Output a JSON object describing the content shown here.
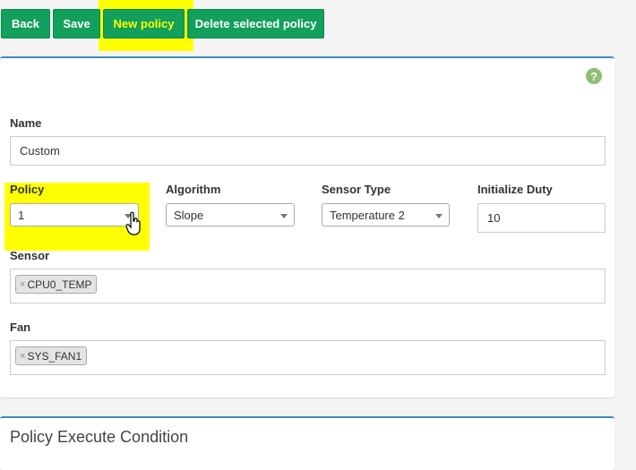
{
  "toolbar": {
    "back_label": "Back",
    "save_label": "Save",
    "new_policy_label": "New policy",
    "delete_label": "Delete selected policy"
  },
  "help_icon": "question-circle-icon",
  "form": {
    "name_label": "Name",
    "name_value": "Custom",
    "policy_label": "Policy",
    "policy_value": "1",
    "algorithm_label": "Algorithm",
    "algorithm_value": "Slope",
    "sensor_type_label": "Sensor Type",
    "sensor_type_value": "Temperature 2",
    "init_duty_label": "Initialize Duty",
    "init_duty_value": "10",
    "sensor_label": "Sensor",
    "sensor_tags": [
      "CPU0_TEMP"
    ],
    "fan_label": "Fan",
    "fan_tags": [
      "SYS_FAN1"
    ],
    "tag_remove_glyph": "×"
  },
  "condition_panel": {
    "title": "Policy Execute Condition"
  },
  "colors": {
    "button_green": "#12a05c",
    "highlight_yellow": "#ffff00",
    "panel_border_blue": "#3c8dbc",
    "help_green": "#8fbf76"
  }
}
